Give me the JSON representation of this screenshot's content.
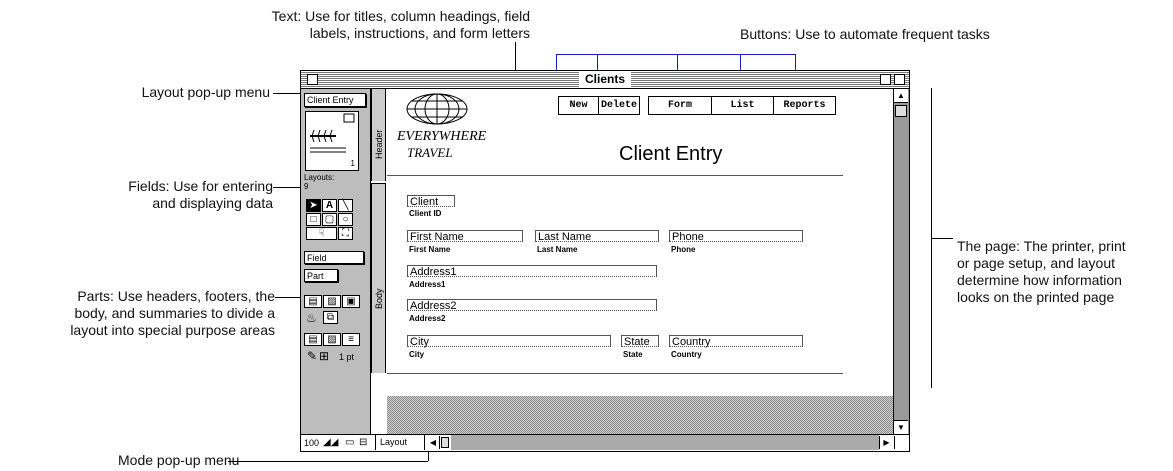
{
  "callouts": {
    "text_tool_1": "Text: Use for titles, column headings, field",
    "text_tool_2": "labels, instructions, and form letters",
    "buttons": "Buttons: Use to automate frequent tasks",
    "layout_menu": "Layout pop-up menu",
    "fields_1": "Fields: Use for entering",
    "fields_2": "and displaying data",
    "parts_1": "Parts: Use headers, footers, the",
    "parts_2": "body, and summaries to divide a",
    "parts_3": "layout into special purpose areas",
    "page_1": "The page: The printer, print",
    "page_2": "or page setup, and layout",
    "page_3": "determine how information",
    "page_4": "looks on the printed page",
    "mode_menu": "Mode pop-up menu"
  },
  "window": {
    "title": "Clients"
  },
  "tool_panel": {
    "layout_menu": "Client Entry",
    "book_page": "1",
    "layouts_label": "Layouts:",
    "layouts_count": "9",
    "field_button": "Field",
    "part_button": "Part",
    "line_width": "1 pt"
  },
  "parts": {
    "header": "Header",
    "body": "Body"
  },
  "logo": {
    "line1": "EVERYWHERE",
    "line2": "TRAVEL"
  },
  "layout_buttons": [
    "New",
    "Delete",
    "Form",
    "List",
    "Reports"
  ],
  "layout_title": "Client Entry",
  "fields": [
    {
      "field": "Client",
      "label": "Client ID"
    },
    {
      "field": "First Name",
      "label": "First Name"
    },
    {
      "field": "Last Name",
      "label": "Last Name"
    },
    {
      "field": "Phone",
      "label": "Phone"
    },
    {
      "field": "Address1",
      "label": "Address1"
    },
    {
      "field": "Address2",
      "label": "Address2"
    },
    {
      "field": "City",
      "label": "City"
    },
    {
      "field": "State",
      "label": "State"
    },
    {
      "field": "Country",
      "label": "Country"
    }
  ],
  "status_bar": {
    "zoom": "100",
    "mode": "Layout"
  },
  "colors": {
    "callout_line": "#1a1ad6",
    "panel": "#bdbdbd"
  }
}
